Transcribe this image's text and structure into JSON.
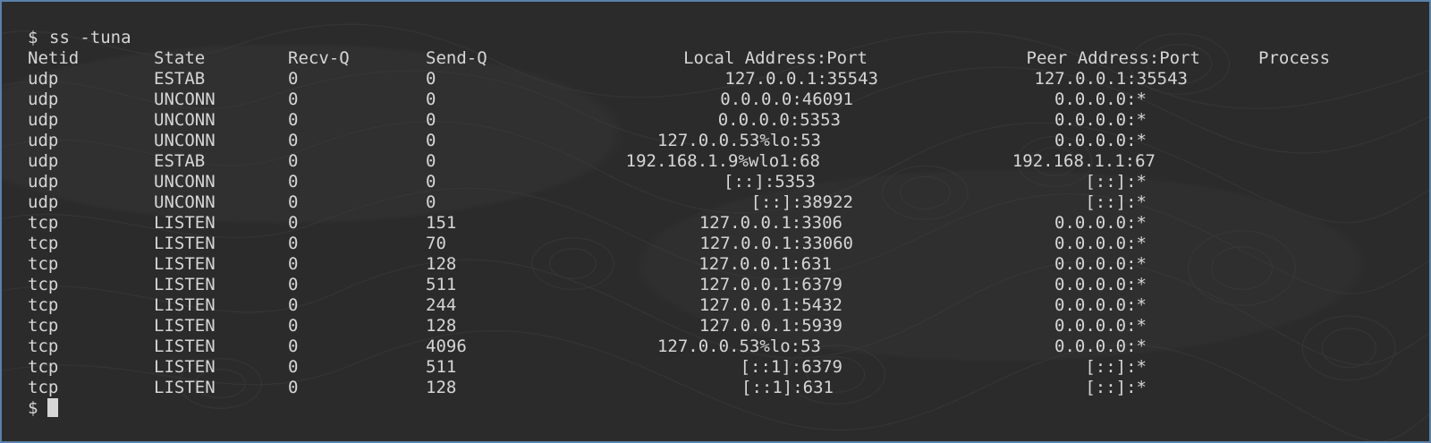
{
  "terminal": {
    "prompt": "$",
    "command": "ss -tuna",
    "headers": [
      "Netid",
      "State",
      "Recv-Q",
      "Send-Q",
      "Local Address:Port",
      "Peer Address:Port",
      "Process"
    ],
    "rows": [
      [
        "udp",
        "ESTAB",
        "0",
        "0",
        "127.0.0.1:35543",
        "127.0.0.1:35543"
      ],
      [
        "udp",
        "UNCONN",
        "0",
        "0",
        "0.0.0.0:46091",
        "0.0.0.0:*"
      ],
      [
        "udp",
        "UNCONN",
        "0",
        "0",
        "0.0.0.0:5353",
        "0.0.0.0:*"
      ],
      [
        "udp",
        "UNCONN",
        "0",
        "0",
        "127.0.0.53%lo:53",
        "0.0.0.0:*"
      ],
      [
        "udp",
        "ESTAB",
        "0",
        "0",
        "192.168.1.9%wlo1:68",
        "192.168.1.1:67"
      ],
      [
        "udp",
        "UNCONN",
        "0",
        "0",
        "[::]:5353",
        "[::]:*"
      ],
      [
        "udp",
        "UNCONN",
        "0",
        "0",
        "[::]:38922",
        "[::]:*"
      ],
      [
        "tcp",
        "LISTEN",
        "0",
        "151",
        "127.0.0.1:3306",
        "0.0.0.0:*"
      ],
      [
        "tcp",
        "LISTEN",
        "0",
        "70",
        "127.0.0.1:33060",
        "0.0.0.0:*"
      ],
      [
        "tcp",
        "LISTEN",
        "0",
        "128",
        "127.0.0.1:631",
        "0.0.0.0:*"
      ],
      [
        "tcp",
        "LISTEN",
        "0",
        "511",
        "127.0.0.1:6379",
        "0.0.0.0:*"
      ],
      [
        "tcp",
        "LISTEN",
        "0",
        "244",
        "127.0.0.1:5432",
        "0.0.0.0:*"
      ],
      [
        "tcp",
        "LISTEN",
        "0",
        "128",
        "127.0.0.1:5939",
        "0.0.0.0:*"
      ],
      [
        "tcp",
        "LISTEN",
        "0",
        "4096",
        "127.0.0.53%lo:53",
        "0.0.0.0:*"
      ],
      [
        "tcp",
        "LISTEN",
        "0",
        "511",
        "[::1]:6379",
        "[::]:*"
      ],
      [
        "tcp",
        "LISTEN",
        "0",
        "128",
        "[::1]:631",
        "[::]:*"
      ]
    ],
    "final_prompt": "$"
  },
  "colors": {
    "background": "#2b2b2b",
    "text": "#d6d6d6",
    "border": "#5b82a8"
  }
}
